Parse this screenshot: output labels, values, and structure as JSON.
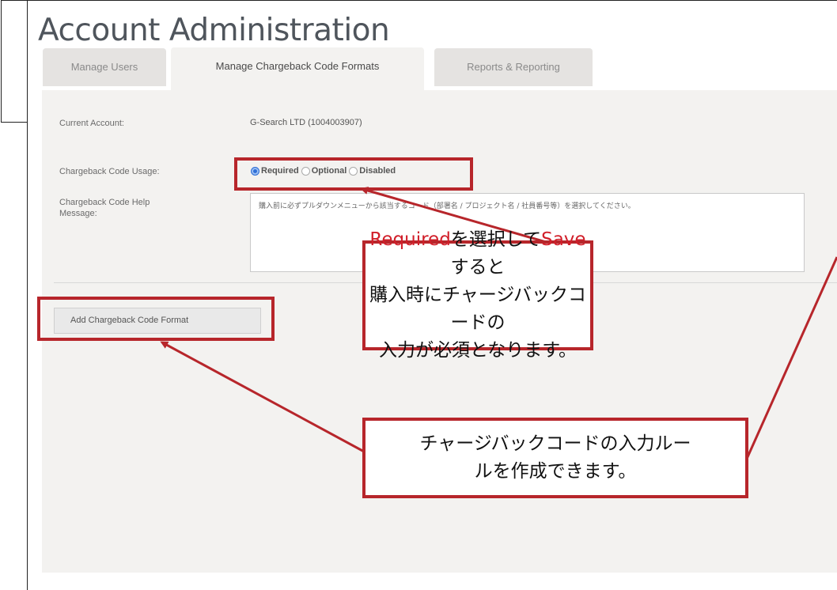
{
  "header": {
    "title": "Account Administration"
  },
  "tabs": [
    {
      "label": "Manage Users"
    },
    {
      "label": "Manage Chargeback Code Formats"
    },
    {
      "label": "Reports & Reporting"
    }
  ],
  "form": {
    "current_account_label": "Current Account:",
    "current_account_value": "G-Search LTD (1004003907)",
    "usage_label": "Chargeback Code Usage:",
    "usage_options": [
      "Required",
      "Optional",
      "Disabled"
    ],
    "usage_selected": "Required",
    "help_label_line1": "Chargeback Code Help",
    "help_label_line2": "Message:",
    "help_message": "購入前に必ずプルダウンメニューから該当するコード（部署名 / プロジェクト名 / 社員番号等）を選択してください。",
    "add_button_label": "Add Chargeback Code Format"
  },
  "callouts": {
    "required_kw": "Required",
    "required_mid": "を選択して",
    "save_kw": "Save",
    "required_tail": "すると",
    "required_line2": "購入時にチャージバックコードの",
    "required_line3": "入力が必須となります。",
    "format_line1": "チャージバックコードの入力ルー",
    "format_line2": "ルを作成できます。"
  },
  "colors": {
    "annotation": "#b7262b",
    "highlight": "#d11f2a",
    "radio_selected": "#2f6fd6"
  }
}
